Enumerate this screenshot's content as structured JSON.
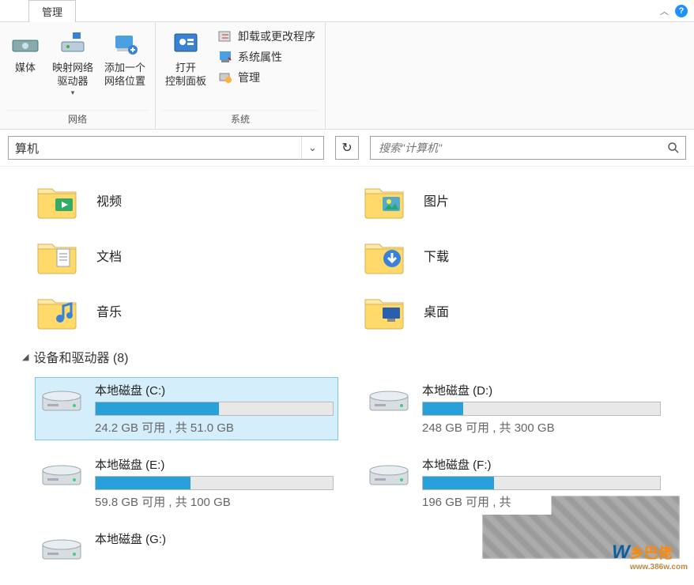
{
  "tab": {
    "label": "管理"
  },
  "ribbon": {
    "group1": {
      "label": "网络",
      "btn_media": "媒体",
      "btn_media2": "媒体",
      "btn_map_drive": "映射网络\n驱动器",
      "btn_add_loc": "添加一个\n网络位置"
    },
    "group2": {
      "label": "系统",
      "btn_open_cp": "打开\n控制面板",
      "link_uninstall": "卸载或更改程序",
      "link_sysprops": "系统属性",
      "link_manage": "管理"
    }
  },
  "address": {
    "text": "算机",
    "search_placeholder": "搜索\"计算机\""
  },
  "libraries": [
    {
      "label": "视频",
      "icon": "videos"
    },
    {
      "label": "图片",
      "icon": "pictures"
    },
    {
      "label": "文档",
      "icon": "documents"
    },
    {
      "label": "下载",
      "icon": "downloads"
    },
    {
      "label": "音乐",
      "icon": "music"
    },
    {
      "label": "桌面",
      "icon": "desktop"
    }
  ],
  "section_drives": {
    "title": "设备和驱动器 (8)"
  },
  "drives": [
    {
      "name": "本地磁盘 (C:)",
      "free": "24.2 GB",
      "total": "51.0 GB",
      "pct": 52,
      "selected": true
    },
    {
      "name": "本地磁盘 (D:)",
      "free": "248 GB",
      "total": "300 GB",
      "pct": 17,
      "selected": false
    },
    {
      "name": "本地磁盘 (E:)",
      "free": "59.8 GB",
      "total": "100 GB",
      "pct": 40,
      "selected": false
    },
    {
      "name": "本地磁盘 (F:)",
      "free": "196 GB",
      "total": "",
      "pct": 30,
      "selected": false
    },
    {
      "name": "本地磁盘 (G:)",
      "free": "",
      "total": "",
      "pct": 0,
      "selected": false
    }
  ],
  "text": {
    "free_label": "可用",
    "total_label": "共",
    "sep": " , "
  },
  "watermark": {
    "brand": "乡巴佬",
    "url": "www.386w.com"
  }
}
